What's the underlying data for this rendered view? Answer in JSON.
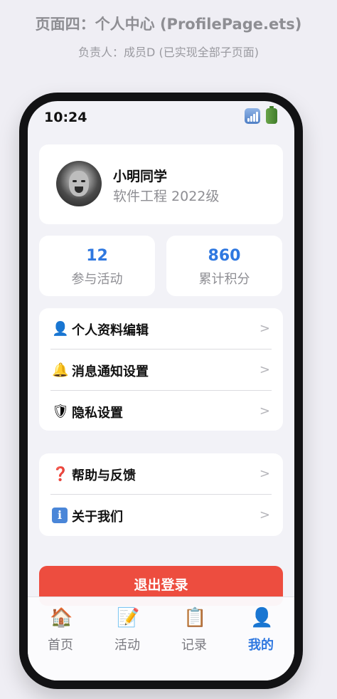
{
  "caption": {
    "title": "页面四：个人中心 (ProfilePage.ets)",
    "subtitle": "负责人：成员D (已实现全部子页面)"
  },
  "status_bar": {
    "time": "10:24",
    "icons": [
      "signal-icon",
      "battery-icon"
    ]
  },
  "profile": {
    "name": "小明同学",
    "department": "软件工程 2022级"
  },
  "stats": [
    {
      "value": "12",
      "label": "参与活动"
    },
    {
      "value": "860",
      "label": "累计积分"
    }
  ],
  "menu_group_1": [
    {
      "icon": "user-icon",
      "glyph": "👤",
      "label": "个人资料编辑",
      "arrow": ">"
    },
    {
      "icon": "bell-icon",
      "glyph": "🔔",
      "label": "消息通知设置",
      "arrow": ">"
    },
    {
      "icon": "shield-icon",
      "glyph": "🛡",
      "label": "隐私设置",
      "arrow": ">"
    }
  ],
  "menu_group_2": [
    {
      "icon": "question-icon",
      "glyph": "❓",
      "label": "帮助与反馈",
      "arrow": ">"
    },
    {
      "icon": "info-icon",
      "glyph": "ℹ",
      "label": "关于我们",
      "arrow": ">"
    }
  ],
  "logout": {
    "label": "退出登录"
  },
  "colors": {
    "accent": "#2f78e0",
    "danger": "#ed4d3f",
    "background": "#f2f2f7"
  },
  "tabs": [
    {
      "icon": "home-icon",
      "glyph": "🏠",
      "label": "首页",
      "active": false
    },
    {
      "icon": "memo-icon",
      "glyph": "📝",
      "label": "活动",
      "active": false
    },
    {
      "icon": "clipboard-icon",
      "glyph": "📋",
      "label": "记录",
      "active": false
    },
    {
      "icon": "profile-icon",
      "glyph": "👤",
      "label": "我的",
      "active": true
    }
  ]
}
